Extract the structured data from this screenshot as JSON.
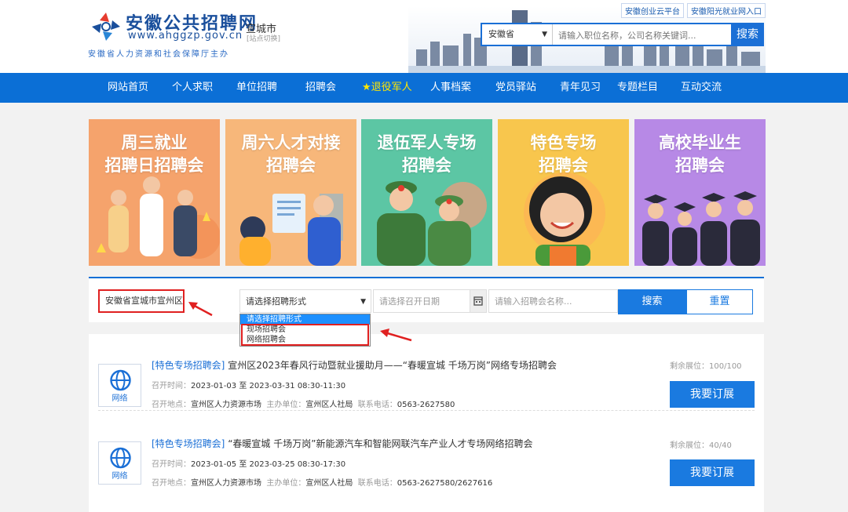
{
  "header": {
    "logo_title": "安徽公共招聘网",
    "logo_url": "www.ahggzp.gov.cn",
    "logo_sub": "安徽省人力资源和社会保障厅主办",
    "city": "宣城市",
    "city_switch": "[站点切换]",
    "top_links": [
      "安徽创业云平台",
      "安徽阳光就业网入口"
    ],
    "province_select": "安徽省",
    "search_placeholder": "请输入职位名称，公司名称关键词...",
    "search_button": "搜索"
  },
  "nav": {
    "items": [
      "网站首页",
      "个人求职",
      "单位招聘",
      "招聘会",
      "★退役军人",
      "人事档案",
      "党员驿站",
      "青年见习",
      "专题栏目",
      "互动交流"
    ],
    "highlight_index": 4
  },
  "banners": [
    {
      "line1": "周三就业",
      "line2": "招聘日招聘会",
      "color": "#f5a36c"
    },
    {
      "line1": "周六人才对接",
      "line2": "招聘会",
      "color": "#f7b77a"
    },
    {
      "line1": "退伍军人专场",
      "line2": "招聘会",
      "color": "#5cc6a4"
    },
    {
      "line1": "特色专场",
      "line2": "招聘会",
      "color": "#f8c64d"
    },
    {
      "line1": "高校毕业生",
      "line2": "招聘会",
      "color": "#b789e6"
    }
  ],
  "filter": {
    "region": "安徽省宣城市宣州区",
    "type_placeholder": "请选择招聘形式",
    "date_placeholder": "请选择召开日期",
    "name_placeholder": "请输入招聘会名称...",
    "search_button": "搜索",
    "reset_button": "重置",
    "dropdown_options": [
      "请选择招聘形式",
      "现场招聘会",
      "网络招聘会"
    ],
    "dropdown_selected_index": 0
  },
  "list": {
    "labels": {
      "time": "召开时间：",
      "to": "至",
      "place": "召开地点：",
      "organizer": "主办单位：",
      "phone": "联系电话：",
      "remain": "剩余展位：",
      "book": "我要订展"
    },
    "items": [
      {
        "icon_label": "网络",
        "tag": "[特色专场招聘会]",
        "title": "宣州区2023年春风行动暨就业援助月——“春暖宣城 千场万岗”网络专场招聘会",
        "start": "2023-01-03",
        "end": "2023-03-31",
        "hours": "08:30-11:30",
        "place": "宣州区人力资源市场",
        "organizer": "宣州区人社局",
        "phone": "0563-2627580",
        "remain": "100/100"
      },
      {
        "icon_label": "网络",
        "tag": "[特色专场招聘会]",
        "title": "“春暖宣城 千场万岗”新能源汽车和智能网联汽车产业人才专场网络招聘会",
        "start": "2023-01-05",
        "end": "2023-03-25",
        "hours": "08:30-17:30",
        "place": "宣州区人力资源市场",
        "organizer": "宣州区人社局",
        "phone": "0563-2627580/2627616",
        "remain": "40/40"
      }
    ]
  },
  "colors": {
    "brand_blue": "#0b6fd6",
    "button_blue": "#1a7ae0",
    "annotation_red": "#e02020",
    "nav_highlight": "#ffe600"
  }
}
